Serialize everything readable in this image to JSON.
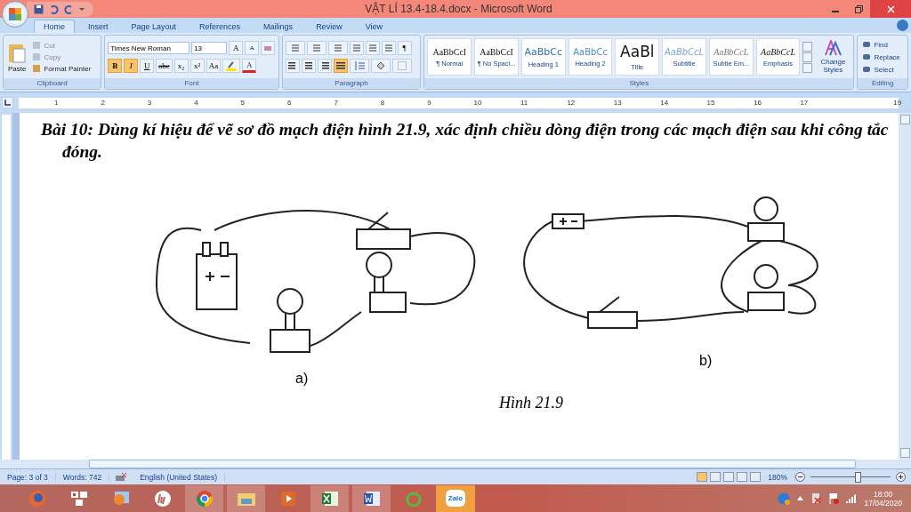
{
  "window": {
    "title": "VẬT LÍ 13.4-18.4.docx - Microsoft Word"
  },
  "tabs": [
    {
      "label": "Home",
      "selected": true
    },
    {
      "label": "Insert",
      "selected": false
    },
    {
      "label": "Page Layout",
      "selected": false
    },
    {
      "label": "References",
      "selected": false
    },
    {
      "label": "Mailings",
      "selected": false
    },
    {
      "label": "Review",
      "selected": false
    },
    {
      "label": "View",
      "selected": false
    }
  ],
  "clipboard": {
    "paste": "Paste",
    "commands": [
      "Cut",
      "Copy",
      "Format Painter"
    ],
    "label": "Clipboard"
  },
  "font": {
    "name": "Times New Roman",
    "size": "13",
    "label": "Font",
    "grow": "A",
    "shrink": "A",
    "color_letter": "A",
    "format_buttons": [
      {
        "label": "B",
        "on": true,
        "kind": "bold"
      },
      {
        "label": "I",
        "on": true,
        "kind": "italic"
      },
      {
        "label": "U",
        "on": false,
        "kind": "underline"
      },
      {
        "label": "abe",
        "on": false,
        "kind": "strike"
      },
      {
        "label": "x₂",
        "on": false,
        "kind": "plain"
      },
      {
        "label": "x²",
        "on": false,
        "kind": "plain"
      },
      {
        "label": "Aa",
        "on": false,
        "kind": "plain"
      }
    ]
  },
  "paragraph": {
    "label": "Paragraph",
    "pilcrow": "¶",
    "align": [
      {
        "kind": "left",
        "selected": false
      },
      {
        "kind": "center",
        "selected": false
      },
      {
        "kind": "right",
        "selected": false
      },
      {
        "kind": "justify",
        "selected": true
      }
    ]
  },
  "styles": {
    "label": "Styles",
    "change": "Change Styles",
    "items": [
      {
        "sample": "AaBbCcI",
        "name": "¶ Normal",
        "kind": "normal"
      },
      {
        "sample": "AaBbCcI",
        "name": "¶ No Spaci...",
        "kind": "normal"
      },
      {
        "sample": "AaBbCc",
        "name": "Heading 1",
        "kind": "heading1"
      },
      {
        "sample": "AaBbCc",
        "name": "Heading 2",
        "kind": "heading2"
      },
      {
        "sample": "AaBl",
        "name": "Title",
        "kind": "title"
      },
      {
        "sample": "AaBbCcL",
        "name": "Subtitle",
        "kind": "subtitle"
      },
      {
        "sample": "AaBbCcL",
        "name": "Subtle Em...",
        "kind": "subtle"
      },
      {
        "sample": "AaBbCcL",
        "name": "Emphasis",
        "kind": "emphasis"
      }
    ]
  },
  "editing": {
    "label": "Editing",
    "commands": [
      "Find",
      "Replace",
      "Select"
    ]
  },
  "ruler": [
    "1",
    "2",
    "3",
    "4",
    "5",
    "6",
    "7",
    "8",
    "9",
    "10",
    "11",
    "12",
    "13",
    "14",
    "15",
    "16",
    "17",
    "19"
  ],
  "document": {
    "paragraph": "Bài 10: Dùng kí hiệu để vẽ sơ đồ mạch điện hình 21.9, xác định chiều dòng điện trong các mạch điện sau khi công tắc đóng.",
    "figure": {
      "label_a": "a)",
      "label_b": "b)",
      "caption": "Hình 21.9"
    }
  },
  "status_bar": {
    "page": "Page: 3 of 3",
    "words": "Words: 742",
    "language": "English (United States)",
    "zoom": "180%",
    "zoom_slider": {
      "level": 0.62
    }
  },
  "taskbar": {
    "apps": [
      {
        "kind": "firefox",
        "selected": false
      },
      {
        "kind": "unikey",
        "selected": false
      },
      {
        "kind": "photos",
        "selected": false
      },
      {
        "kind": "hp",
        "selected": false
      },
      {
        "kind": "chrome",
        "selected": true
      },
      {
        "kind": "folder",
        "selected": true
      },
      {
        "kind": "media",
        "selected": false
      },
      {
        "kind": "excel",
        "selected": true
      },
      {
        "kind": "word",
        "selected": true
      },
      {
        "kind": "coccoc",
        "selected": false
      },
      {
        "kind": "zalo",
        "selected": false,
        "text": "Zalo"
      }
    ],
    "time": "18:00",
    "date": "17/04/2020"
  }
}
